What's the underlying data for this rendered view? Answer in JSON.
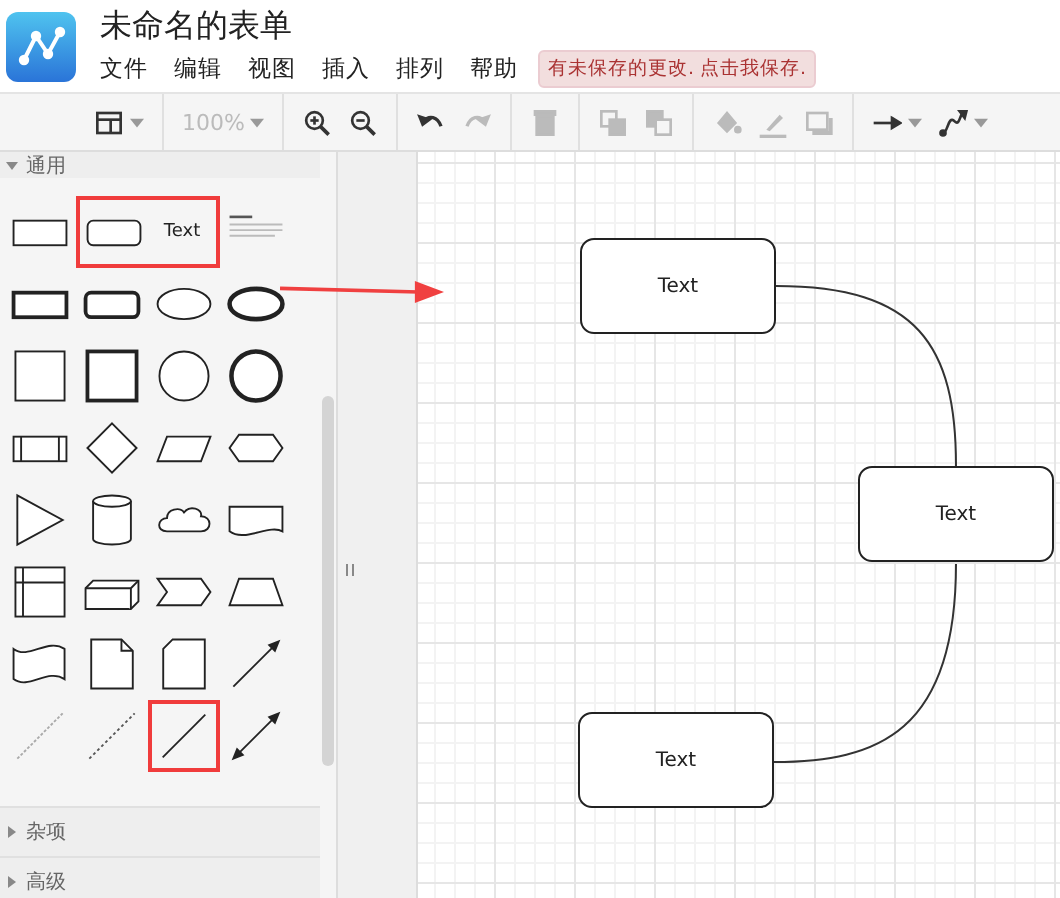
{
  "app": {
    "title": "未命名的表单",
    "menu": [
      "文件",
      "编辑",
      "视图",
      "插入",
      "排列",
      "帮助"
    ],
    "save_notice": "有未保存的更改. 点击我保存."
  },
  "toolbar": [
    [
      {
        "kind": "layout",
        "dropdown": true,
        "disabled": false
      }
    ],
    [
      {
        "kind": "zoom-level",
        "label": "100%",
        "dropdown": true,
        "disabled": true
      }
    ],
    [
      {
        "kind": "zoom-in",
        "disabled": false
      },
      {
        "kind": "zoom-out",
        "disabled": false
      }
    ],
    [
      {
        "kind": "undo",
        "disabled": false
      },
      {
        "kind": "redo",
        "disabled": true
      }
    ],
    [
      {
        "kind": "delete",
        "disabled": true
      }
    ],
    [
      {
        "kind": "to-front",
        "disabled": true
      },
      {
        "kind": "to-back",
        "disabled": true
      }
    ],
    [
      {
        "kind": "fill",
        "disabled": true
      },
      {
        "kind": "line-color",
        "disabled": true
      },
      {
        "kind": "shadow",
        "disabled": true
      }
    ],
    [
      {
        "kind": "connection",
        "dropdown": true,
        "disabled": false
      },
      {
        "kind": "waypoints",
        "dropdown": true,
        "disabled": false
      }
    ]
  ],
  "sidebar": {
    "sections": [
      {
        "label": "通用",
        "expanded": true,
        "shapes": [
          {
            "kind": "rect",
            "highlighted": false
          },
          {
            "kind": "rounded",
            "highlighted": true
          },
          {
            "kind": "text",
            "label": "Text",
            "highlighted": true
          },
          {
            "kind": "textbox",
            "highlighted": false
          },
          {
            "kind": "rect-thick",
            "highlighted": false
          },
          {
            "kind": "rounded-thick",
            "highlighted": false
          },
          {
            "kind": "ellipse",
            "highlighted": false
          },
          {
            "kind": "ellipse-double",
            "highlighted": false
          },
          {
            "kind": "square",
            "highlighted": false
          },
          {
            "kind": "square-thick",
            "highlighted": false
          },
          {
            "kind": "circle",
            "highlighted": false
          },
          {
            "kind": "circle-double",
            "highlighted": false
          },
          {
            "kind": "process",
            "highlighted": false
          },
          {
            "kind": "diamond",
            "highlighted": false
          },
          {
            "kind": "parallelogram",
            "highlighted": false
          },
          {
            "kind": "hexagon",
            "highlighted": false
          },
          {
            "kind": "triangle",
            "highlighted": false
          },
          {
            "kind": "cylinder",
            "highlighted": false
          },
          {
            "kind": "cloud",
            "highlighted": false
          },
          {
            "kind": "document",
            "highlighted": false
          },
          {
            "kind": "internal-storage",
            "highlighted": false
          },
          {
            "kind": "cube",
            "highlighted": false
          },
          {
            "kind": "step",
            "highlighted": false
          },
          {
            "kind": "trapezoid",
            "highlighted": false
          },
          {
            "kind": "tape",
            "highlighted": false
          },
          {
            "kind": "note",
            "highlighted": false
          },
          {
            "kind": "card",
            "highlighted": false
          },
          {
            "kind": "arrow",
            "highlighted": false
          },
          {
            "kind": "dashed-line",
            "highlighted": false
          },
          {
            "kind": "dotted-line",
            "highlighted": false
          },
          {
            "kind": "line",
            "highlighted": true
          },
          {
            "kind": "double-arrow",
            "highlighted": false
          }
        ]
      },
      {
        "label": "杂项",
        "expanded": false
      },
      {
        "label": "高级",
        "expanded": false
      }
    ]
  },
  "canvas": {
    "nodes": [
      {
        "label": "Text"
      },
      {
        "label": "Text"
      },
      {
        "label": "Text"
      }
    ]
  }
}
